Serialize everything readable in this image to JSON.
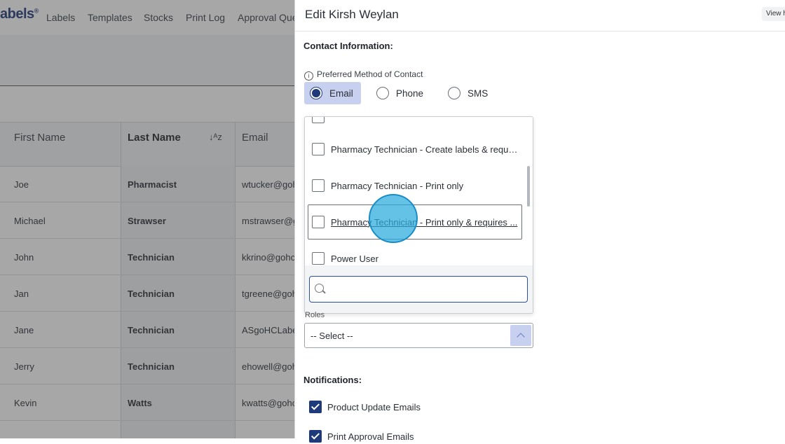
{
  "app": {
    "brand": "abels",
    "nav": [
      "Labels",
      "Templates",
      "Stocks",
      "Print Log",
      "Approval Que"
    ]
  },
  "table": {
    "headers": [
      "First Name",
      "Last Name",
      "Email"
    ],
    "rows": [
      {
        "first": "Joe",
        "last": "Pharmacist",
        "email": "wtucker@goh"
      },
      {
        "first": "Michael",
        "last": "Strawser",
        "email": "mstrawser@g"
      },
      {
        "first": "John",
        "last": "Technician",
        "email": "kkrino@gohc"
      },
      {
        "first": "Jan",
        "last": "Technician",
        "email": "tgreene@goh"
      },
      {
        "first": "Jane",
        "last": "Technician",
        "email": "ASgoHCLabe"
      },
      {
        "first": "Jerry",
        "last": "Technician",
        "email": "ehowell@goh"
      },
      {
        "first": "Kevin",
        "last": "Watts",
        "email": "kwatts@gohc"
      }
    ]
  },
  "panel": {
    "title": "Edit Kirsh Weylan",
    "view_button": "View h",
    "contact_section": "Contact Information:",
    "preferred_label": "Preferred Method of Contact",
    "contact_options": [
      "Email",
      "Phone",
      "SMS"
    ],
    "selected_contact": "Email",
    "roles_dropdown": {
      "options": [
        "Pharmacy Technician - Create labels & requir...",
        "Pharmacy Technician - Print only",
        "Pharmacy Technician - Print only & requires ...",
        "Power User"
      ],
      "search_placeholder": ""
    },
    "roles_label": "Roles",
    "roles_value": "-- Select --",
    "notifications_section": "Notifications:",
    "notifications": [
      {
        "label": "Product Update Emails",
        "checked": true
      },
      {
        "label": "Print Approval Emails",
        "checked": true
      }
    ]
  }
}
